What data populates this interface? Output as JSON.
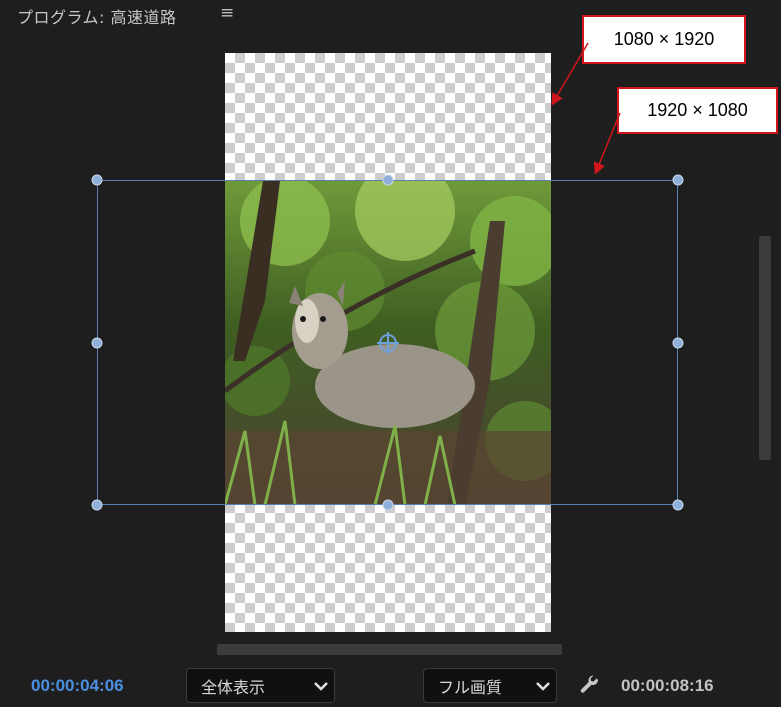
{
  "panel": {
    "title": "プログラム: 高速道路",
    "menu_glyph": "≡"
  },
  "annotations": {
    "vertical_size": "1080 × 1920",
    "horizontal_size": "1920 × 1080",
    "color": "#d0161c"
  },
  "footer": {
    "current_time": "00:00:04:06",
    "zoom_select": "全体表示",
    "quality_select": "フル画質",
    "duration": "00:00:08:16"
  },
  "colors": {
    "accent_timecode": "#4a8fe0",
    "bbox": "#5a7fb0"
  }
}
